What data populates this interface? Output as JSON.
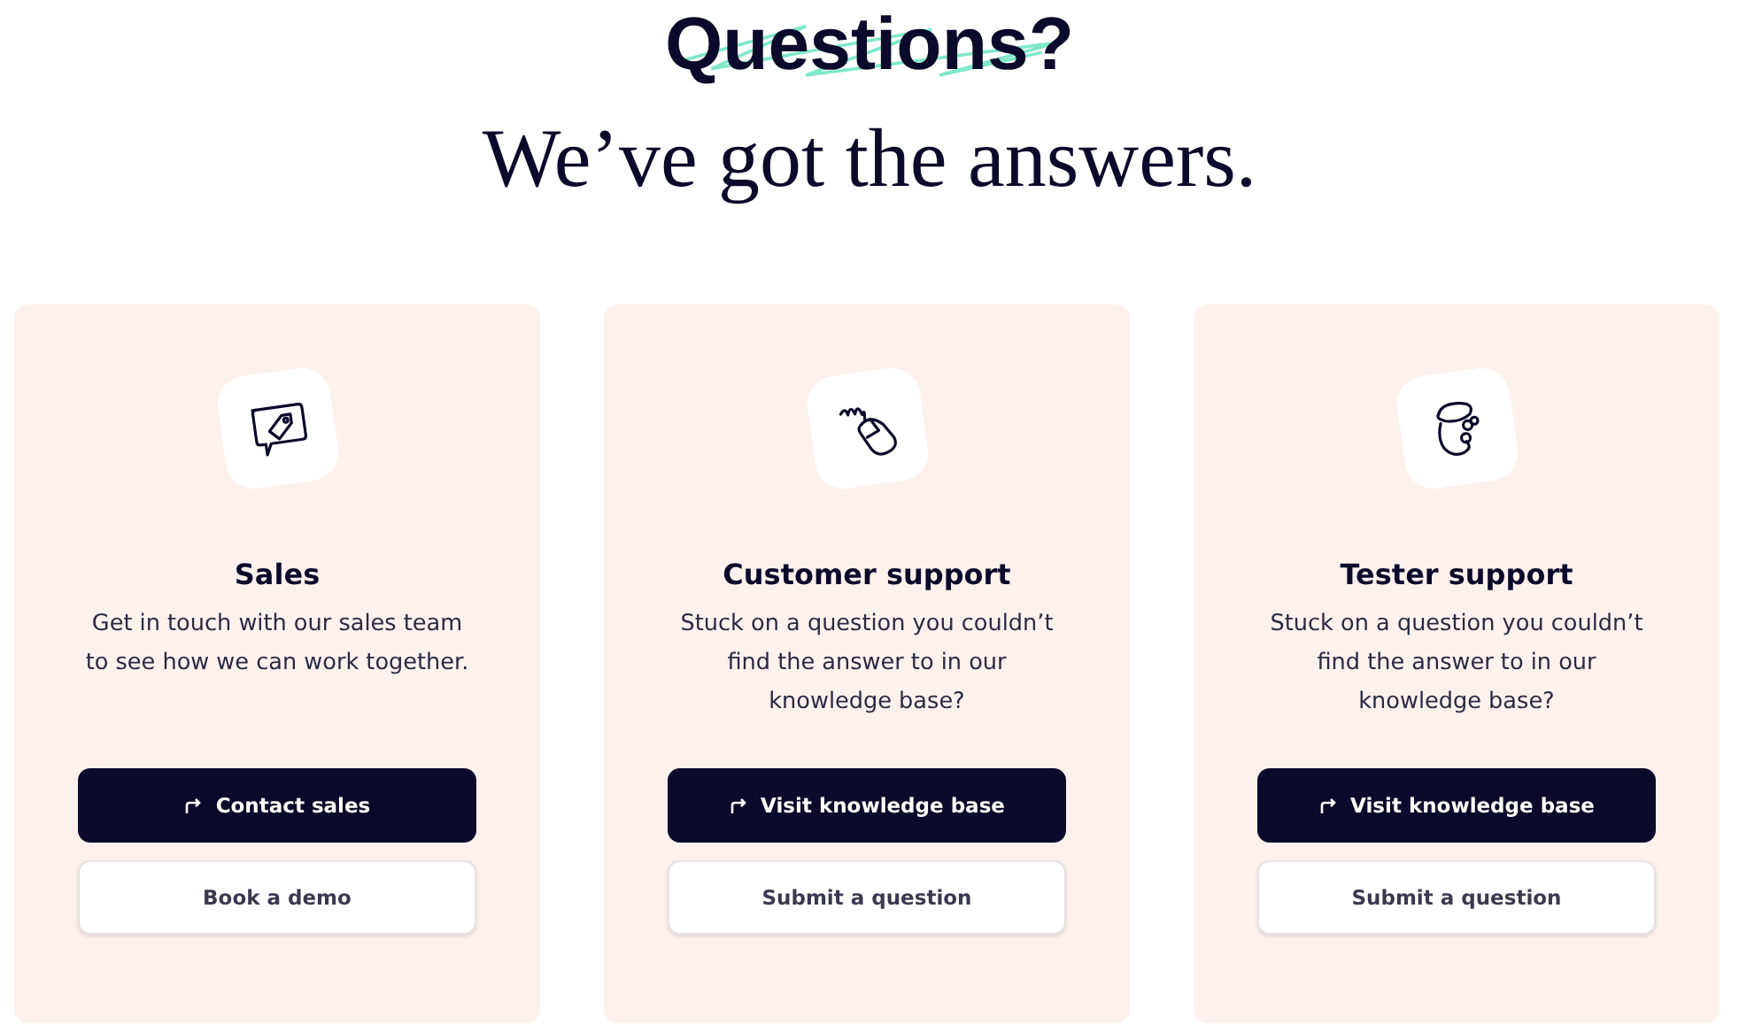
{
  "heading": {
    "scribbled_word": "Questions?",
    "subtitle": "We’ve got the answers."
  },
  "cards": [
    {
      "title": "Sales",
      "description": "Get in touch with our sales team to see how we can work together.",
      "primary_button": "Contact sales",
      "secondary_button": "Book a demo"
    },
    {
      "title": "Customer support",
      "description": "Stuck on a question you couldn’t find the answer to in our knowledge base?",
      "primary_button": "Visit knowledge base",
      "secondary_button": "Submit a question"
    },
    {
      "title": "Tester support",
      "description": "Stuck on a question you couldn’t find the answer to in our knowledge base?",
      "primary_button": "Visit knowledge base",
      "secondary_button": "Submit a question"
    }
  ]
}
